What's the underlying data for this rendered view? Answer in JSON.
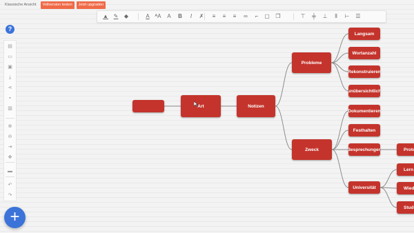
{
  "top_buttons": [
    {
      "label": "Klassische Ansicht"
    },
    {
      "label": "Vollversion testen"
    },
    {
      "label": "Jetzt upgraden"
    }
  ],
  "toolbar": {
    "tools": [
      {
        "icon": "fill-color-icon",
        "glyph": "▲"
      },
      {
        "icon": "line-color-icon",
        "glyph": "✎"
      },
      {
        "icon": "drop-icon",
        "glyph": "◆"
      },
      {
        "icon": "text-color-icon",
        "glyph": "A"
      },
      {
        "icon": "font-size-icon",
        "glyph": "ᴬA"
      },
      {
        "icon": "text-style-icon",
        "glyph": "A"
      },
      {
        "icon": "bold-icon",
        "glyph": "B"
      },
      {
        "icon": "italic-icon",
        "glyph": "I"
      },
      {
        "icon": "clear-format-icon",
        "glyph": "✗"
      },
      {
        "icon": "align-left-icon",
        "glyph": "≡"
      },
      {
        "icon": "align-center-icon",
        "glyph": "≡"
      },
      {
        "icon": "align-right-icon",
        "glyph": "≡"
      },
      {
        "icon": "link-icon",
        "glyph": "∞"
      },
      {
        "icon": "connect-icon",
        "glyph": "⌐"
      },
      {
        "icon": "shape-icon",
        "glyph": "▢"
      },
      {
        "icon": "duplicate-icon",
        "glyph": "❐"
      },
      {
        "icon": "align-top-icon",
        "glyph": "⊤"
      },
      {
        "icon": "align-middle-icon",
        "glyph": "╪"
      },
      {
        "icon": "align-bottom-icon",
        "glyph": "⊥"
      },
      {
        "icon": "distribute-horizontal-icon",
        "glyph": "⫴"
      },
      {
        "icon": "distribute-vertical-icon",
        "glyph": "⊢"
      },
      {
        "icon": "distribute-spacing-icon",
        "glyph": "☰"
      }
    ]
  },
  "sidebar": {
    "help": "?",
    "tools": [
      {
        "icon": "new-file-icon",
        "glyph": "▤"
      },
      {
        "icon": "open-folder-icon",
        "glyph": "▭"
      },
      {
        "icon": "save-icon",
        "glyph": "▣"
      },
      {
        "icon": "download-icon",
        "glyph": "⤓"
      },
      {
        "icon": "share-icon",
        "glyph": "⋖"
      },
      {
        "icon": "lock-icon",
        "glyph": "▪"
      },
      {
        "icon": "trash-icon",
        "glyph": "▥"
      },
      {
        "icon": "zoom-in-icon",
        "glyph": "⊕"
      },
      {
        "icon": "zoom-out-icon",
        "glyph": "⊖"
      },
      {
        "icon": "fit-screen-icon",
        "glyph": "⇥"
      },
      {
        "icon": "move-icon",
        "glyph": "✥"
      },
      {
        "icon": "presentation-icon",
        "glyph": "▬"
      },
      {
        "icon": "undo-icon",
        "glyph": "↶"
      },
      {
        "icon": "redo-icon",
        "glyph": "↷"
      }
    ],
    "add": "+"
  },
  "mindmap": {
    "nodes": [
      {
        "id": "empty",
        "label": ""
      },
      {
        "id": "art",
        "label": "Art"
      },
      {
        "id": "notizen",
        "label": "Notizen"
      },
      {
        "id": "probleme",
        "label": "Probleme"
      },
      {
        "id": "zweck",
        "label": "Zweck"
      },
      {
        "id": "langsam",
        "label": "Langsam"
      },
      {
        "id": "wortanzahl",
        "label": "Wortanzahl"
      },
      {
        "id": "rekonstruieren",
        "label": "Rekonstruieren"
      },
      {
        "id": "unuebersichtlich",
        "label": "unübersichtlich"
      },
      {
        "id": "dokumentieren",
        "label": "Dokumentieren"
      },
      {
        "id": "festhalten",
        "label": "Festhalten"
      },
      {
        "id": "besprechungen",
        "label": "Besprechungen"
      },
      {
        "id": "universitaet",
        "label": "Universität"
      },
      {
        "id": "protokoll",
        "label": "Protokol"
      },
      {
        "id": "lernen",
        "label": "Lern"
      },
      {
        "id": "wiederholen",
        "label": "Wieder"
      },
      {
        "id": "studieren",
        "label": "Studie"
      }
    ],
    "edges": [
      [
        "empty",
        "art"
      ],
      [
        "art",
        "notizen"
      ],
      [
        "notizen",
        "probleme"
      ],
      [
        "notizen",
        "zweck"
      ],
      [
        "probleme",
        "langsam"
      ],
      [
        "probleme",
        "wortanzahl"
      ],
      [
        "probleme",
        "rekonstruieren"
      ],
      [
        "probleme",
        "unuebersichtlich"
      ],
      [
        "zweck",
        "dokumentieren"
      ],
      [
        "zweck",
        "festhalten"
      ],
      [
        "zweck",
        "besprechungen"
      ],
      [
        "zweck",
        "universitaet"
      ],
      [
        "besprechungen",
        "protokoll"
      ],
      [
        "universitaet",
        "lernen"
      ],
      [
        "universitaet",
        "wiederholen"
      ],
      [
        "universitaet",
        "studieren"
      ]
    ]
  }
}
